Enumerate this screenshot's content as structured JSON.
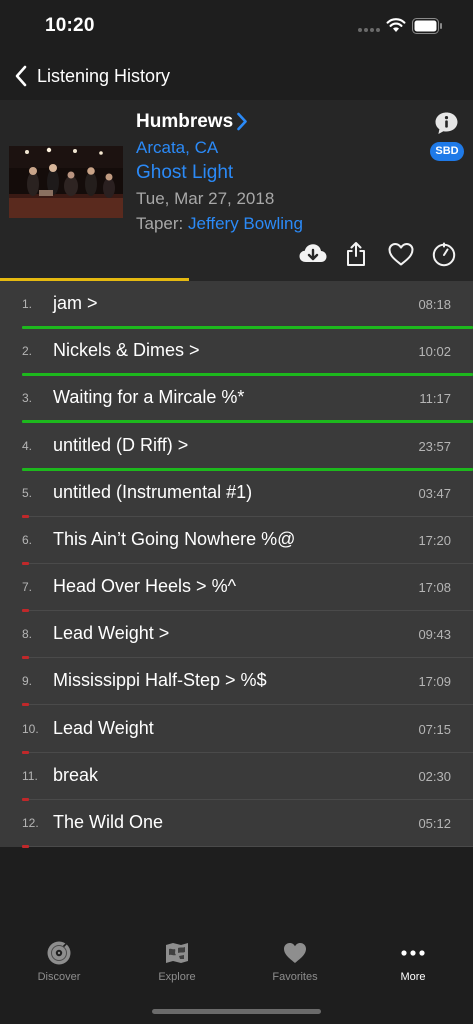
{
  "status_bar": {
    "time": "10:20"
  },
  "nav": {
    "back_label": "Listening History"
  },
  "show": {
    "artist": "Humbrews",
    "location": "Arcata, CA",
    "venue": "Ghost Light",
    "date": "Tue, Mar 27, 2018",
    "taper_label": "Taper: ",
    "taper_name": "Jeffery Bowling",
    "source_badge": "SBD",
    "listen_progress": 0.4
  },
  "colors": {
    "accent_blue": "#2b8af7",
    "progress_yellow": "#e5b910",
    "played_green": "#1db81d",
    "partial_red": "#c0282a"
  },
  "tracks": [
    {
      "num": "1.",
      "title": "jam >",
      "duration": "08:18",
      "played": 1.0,
      "status": "played"
    },
    {
      "num": "2.",
      "title": "Nickels & Dimes >",
      "duration": "10:02",
      "played": 1.0,
      "status": "played"
    },
    {
      "num": "3.",
      "title": "Waiting for a Mircale %*",
      "duration": "11:17",
      "played": 1.0,
      "status": "played"
    },
    {
      "num": "4.",
      "title": "untitled (D Riff) >",
      "duration": "23:57",
      "played": 1.0,
      "status": "played"
    },
    {
      "num": "5.",
      "title": "untitled (Instrumental #1)",
      "duration": "03:47",
      "played": 0.01,
      "status": "partial"
    },
    {
      "num": "6.",
      "title": "This Ain’t Going Nowhere %@",
      "duration": "17:20",
      "played": 0.01,
      "status": "partial"
    },
    {
      "num": "7.",
      "title": "Head Over Heels > %^",
      "duration": "17:08",
      "played": 0.01,
      "status": "partial"
    },
    {
      "num": "8.",
      "title": "Lead Weight >",
      "duration": "09:43",
      "played": 0.01,
      "status": "partial"
    },
    {
      "num": "9.",
      "title": "Mississippi Half-Step > %$",
      "duration": "17:09",
      "played": 0.01,
      "status": "partial"
    },
    {
      "num": "10.",
      "title": "Lead Weight",
      "duration": "07:15",
      "played": 0.01,
      "status": "partial"
    },
    {
      "num": "11.",
      "title": "break",
      "duration": "02:30",
      "played": 0.01,
      "status": "partial"
    },
    {
      "num": "12.",
      "title": "The Wild One",
      "duration": "05:12",
      "played": 0.01,
      "status": "partial"
    }
  ],
  "tabs": [
    {
      "label": "Discover",
      "icon": "record-disc-icon",
      "active": false
    },
    {
      "label": "Explore",
      "icon": "map-icon",
      "active": false
    },
    {
      "label": "Favorites",
      "icon": "heart-icon",
      "active": false
    },
    {
      "label": "More",
      "icon": "ellipsis-icon",
      "active": true
    }
  ]
}
